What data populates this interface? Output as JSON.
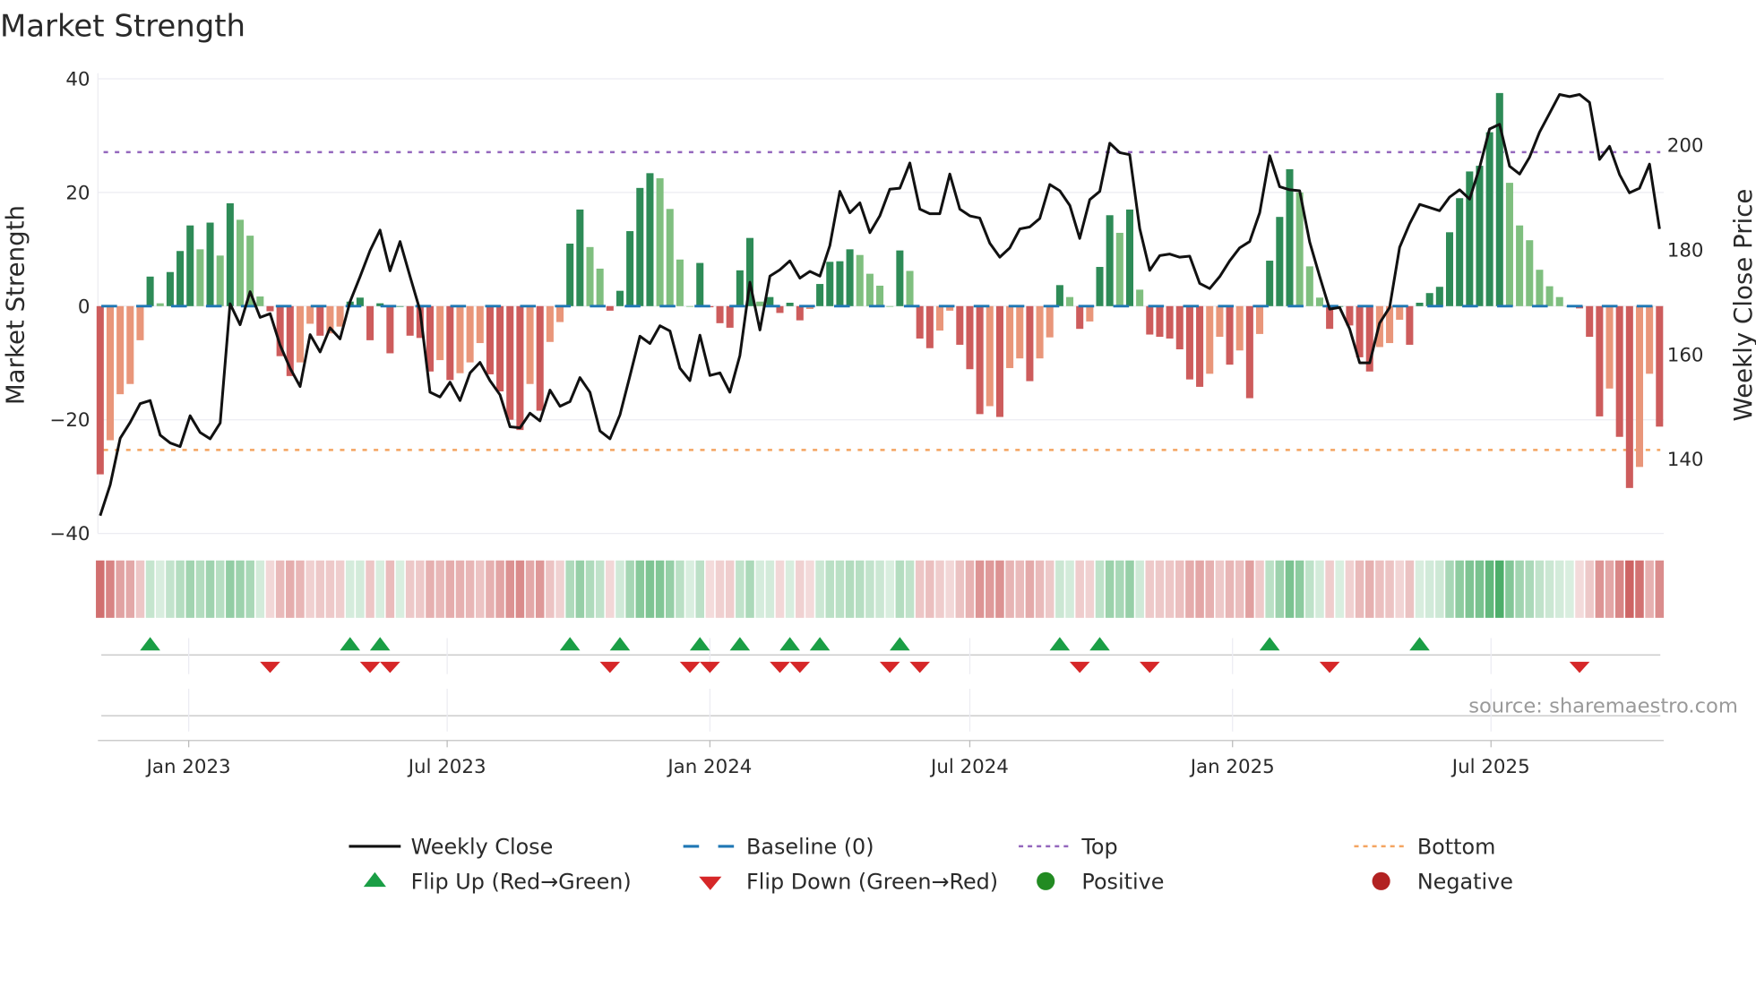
{
  "chart_data": {
    "type": "bar",
    "title": "Market Strength",
    "ylabel": "Market Strength",
    "y2label": "Weekly Close Price",
    "ylim": [
      -40,
      40
    ],
    "y_ticks": [
      "40",
      "20",
      "0",
      "−20",
      "−40"
    ],
    "y_tick_values": [
      40,
      20,
      0,
      -20,
      -40
    ],
    "y2lim": [
      125.8,
      212.7
    ],
    "y2_ticks": [
      "200",
      "180",
      "160",
      "140"
    ],
    "y2_tick_values": [
      200,
      180,
      160,
      140
    ],
    "x_start": "2022-10-31",
    "x_step_days": 7,
    "x_ticks": [
      "Jan 2023",
      "Jul 2023",
      "Jan 2024",
      "Jul 2024",
      "Jan 2025",
      "Jul 2025"
    ],
    "x_tick_dates": [
      "2023-01-01",
      "2023-07-01",
      "2024-01-01",
      "2024-07-01",
      "2025-01-01",
      "2025-07-01"
    ],
    "top_level": 27.1,
    "bottom_level": -25.3,
    "baseline": 0,
    "strength": [
      -29.6,
      -23.6,
      -15.5,
      -13.7,
      -6,
      5.2,
      0.5,
      6,
      9.7,
      14.2,
      10,
      14.7,
      8.9,
      18.1,
      15.2,
      12.4,
      1.7,
      -0.9,
      -8.8,
      -12.3,
      -9.9,
      -3.1,
      -5.2,
      -4.8,
      -3.6,
      0.8,
      1.5,
      -6,
      0.5,
      -8.3,
      0,
      -5.2,
      -5.6,
      -11.5,
      -9.5,
      -13,
      -11.8,
      -9.9,
      -6.5,
      -12,
      -15,
      -20,
      -21.8,
      -13.7,
      -18.4,
      -6.3,
      -2.8,
      11,
      17,
      10.4,
      6.6,
      -0.8,
      2.7,
      13.2,
      20.8,
      23.4,
      22.5,
      17.1,
      8.2,
      0,
      7.6,
      -0.2,
      -3,
      -3.8,
      6.3,
      12,
      0.8,
      1.6,
      -1.2,
      0.6,
      -2.5,
      -0.5,
      3.9,
      7.8,
      7.9,
      10,
      9,
      5.7,
      3.6,
      0,
      9.8,
      6.2,
      -5.7,
      -7.4,
      -4.3,
      -0.8,
      -6.8,
      -11.1,
      -19,
      -17.6,
      -19.5,
      -10.9,
      -9.2,
      -13.2,
      -9.2,
      -5.5,
      3.7,
      1.6,
      -4,
      -2.7,
      6.9,
      16,
      12.9,
      17,
      2.9,
      -5,
      -5.4,
      -5.7,
      -7.6,
      -12.9,
      -14.2,
      -11.9,
      -5.4,
      -10.3,
      -7.8,
      -16.2,
      -4.9,
      8,
      15.7,
      24.1,
      20,
      7,
      1.5,
      -4,
      0,
      -3.4,
      -9,
      -11.5,
      -7.2,
      -6.5,
      -2.4,
      -6.8,
      0.6,
      2.3,
      3.4,
      13,
      19,
      23.7,
      24.7,
      30.6,
      37.5,
      21.7,
      14.2,
      11.6,
      6.4,
      3.5,
      1.6,
      0,
      -0.4,
      -5.4,
      -19.4,
      -14.5,
      -23,
      -32,
      -28.3,
      -11.9,
      -21.2
    ],
    "weekly_close": [
      129.2,
      135.1,
      144,
      147,
      150.6,
      151.2,
      144.6,
      143.1,
      142.4,
      148.3,
      145.1,
      143.9,
      146.9,
      169.7,
      165.7,
      172,
      167.1,
      167.8,
      161.8,
      157.4,
      153.9,
      163.8,
      160.5,
      165.1,
      163,
      170.1,
      174.9,
      179.9,
      183.8,
      176,
      181.6,
      174.9,
      168.4,
      152.8,
      151.9,
      154.7,
      151.2,
      156.5,
      158.5,
      155,
      152.3,
      146.2,
      146,
      148.8,
      147.3,
      153.2,
      150.1,
      151,
      155.6,
      152.8,
      145.4,
      143.9,
      148.5,
      155.9,
      163.5,
      162.1,
      165.5,
      164.5,
      157.4,
      155,
      163.7,
      156,
      156.5,
      152.8,
      159.8,
      173.8,
      164.7,
      175,
      176.2,
      177.9,
      174.6,
      175.9,
      175,
      180.8,
      191.2,
      187.1,
      189,
      183.3,
      186.5,
      191.6,
      191.8,
      196.6,
      187.8,
      186.9,
      186.9,
      194.5,
      187.8,
      186.5,
      186.1,
      181.3,
      178.6,
      180.4,
      184,
      184.4,
      186,
      192.5,
      191.3,
      188.5,
      182.2,
      189.6,
      191.2,
      200.4,
      198.6,
      198.2,
      184.1,
      176.1,
      178.9,
      179.2,
      178.6,
      178.8,
      173.6,
      172.6,
      174.9,
      177.9,
      180.4,
      181.6,
      187.1,
      198,
      192.1,
      191.5,
      191.3,
      181.5,
      174.9,
      168.7,
      169,
      164.9,
      158.4,
      158.4,
      166,
      169,
      180.5,
      185,
      188.7,
      188.1,
      187.5,
      190.1,
      191.5,
      189.7,
      195.7,
      203.1,
      204,
      196,
      194.5,
      197.7,
      202.5,
      206.1,
      209.7,
      209.3,
      209.7,
      208.2,
      197.3,
      199.8,
      194.4,
      190.9,
      191.8,
      196.4,
      184
    ],
    "flip_up_weeks": [
      5,
      25,
      28,
      47,
      52,
      60,
      64,
      69,
      72,
      80,
      96,
      100,
      117,
      132
    ],
    "flip_down_weeks": [
      17,
      27,
      29,
      51,
      59,
      61,
      68,
      70,
      79,
      82,
      98,
      105,
      123,
      148
    ],
    "legend": {
      "position": "bottom",
      "items": [
        {
          "label": "Weekly Close",
          "kind": "line"
        },
        {
          "label": "Baseline (0)",
          "kind": "dash"
        },
        {
          "label": "Top",
          "kind": "dot-purple"
        },
        {
          "label": "Bottom",
          "kind": "dot-orange"
        },
        {
          "label": "Flip Up (Red→Green)",
          "kind": "triangle-up"
        },
        {
          "label": "Flip Down (Green→Red)",
          "kind": "triangle-down"
        },
        {
          "label": "Positive",
          "kind": "circle-green"
        },
        {
          "label": "Negative",
          "kind": "circle-red"
        }
      ]
    },
    "source": "source: sharemaestro.com",
    "colors": {
      "pos_strong": "#2e8b57",
      "pos_weak": "#7fbf7f",
      "neg_strong": "#cd5c5c",
      "neg_weak": "#e9967a",
      "close": "#111111",
      "baseline": "#1f77b4",
      "top": "#9467bd",
      "bottom": "#f4a460",
      "flip_up": "#1a9e45",
      "flip_down": "#d62728",
      "positive": "#228b22",
      "negative": "#b22222"
    }
  }
}
